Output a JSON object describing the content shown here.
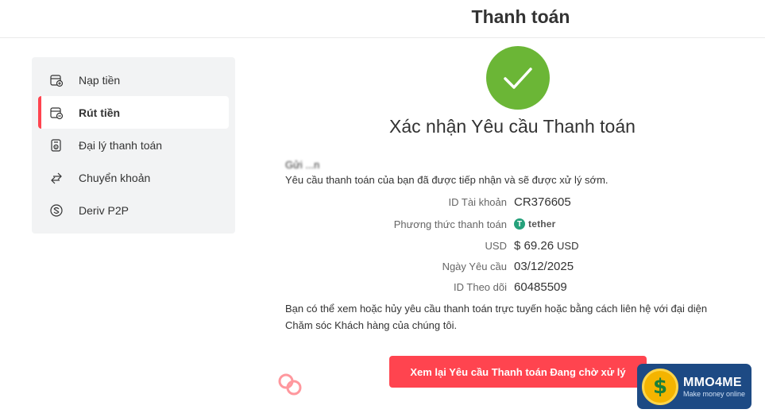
{
  "header": {
    "title": "Thanh toán"
  },
  "sidebar": {
    "items": [
      {
        "label": "Nạp tiền",
        "icon": "deposit-icon",
        "active": false
      },
      {
        "label": "Rút tiền",
        "icon": "withdraw-icon",
        "active": true
      },
      {
        "label": "Đại lý thanh toán",
        "icon": "payment-agent-icon",
        "active": false
      },
      {
        "label": "Chuyển khoản",
        "icon": "transfer-icon",
        "active": false
      },
      {
        "label": "Deriv P2P",
        "icon": "p2p-icon",
        "active": false
      }
    ]
  },
  "main": {
    "title": "Xác nhận Yêu cầu Thanh toán",
    "greeting": "Gửi ...n",
    "message": "Yêu cầu thanh toán của bạn đã được tiếp nhận và sẽ được xử lý sớm.",
    "details": {
      "account_id_label": "ID Tài khoản",
      "account_id_value": "CR376605",
      "method_label": "Phương thức thanh toán",
      "method_value": "tether",
      "amount_label": "USD",
      "amount_value": "$ 69.26",
      "amount_currency": "USD",
      "date_label": "Ngày Yêu cầu",
      "date_value": "03/12/2025",
      "tracking_label": "ID Theo dõi",
      "tracking_value": "60485509"
    },
    "info_line1": "Bạn có thể xem hoặc hủy yêu cầu thanh toán trực tuyến hoặc bằng cách liên hệ với đại diện",
    "info_line2": "Chăm sóc Khách hàng của chúng tôi.",
    "cta_label": "Xem lại Yêu cầu Thanh toán Đang chờ xử lý"
  },
  "watermark": {
    "brand": "MMO4ME",
    "tagline": "Make money online"
  },
  "colors": {
    "accent": "#ff444f",
    "success": "#6bb636",
    "tether": "#26a17b",
    "sidebar_bg": "#f2f3f4"
  }
}
